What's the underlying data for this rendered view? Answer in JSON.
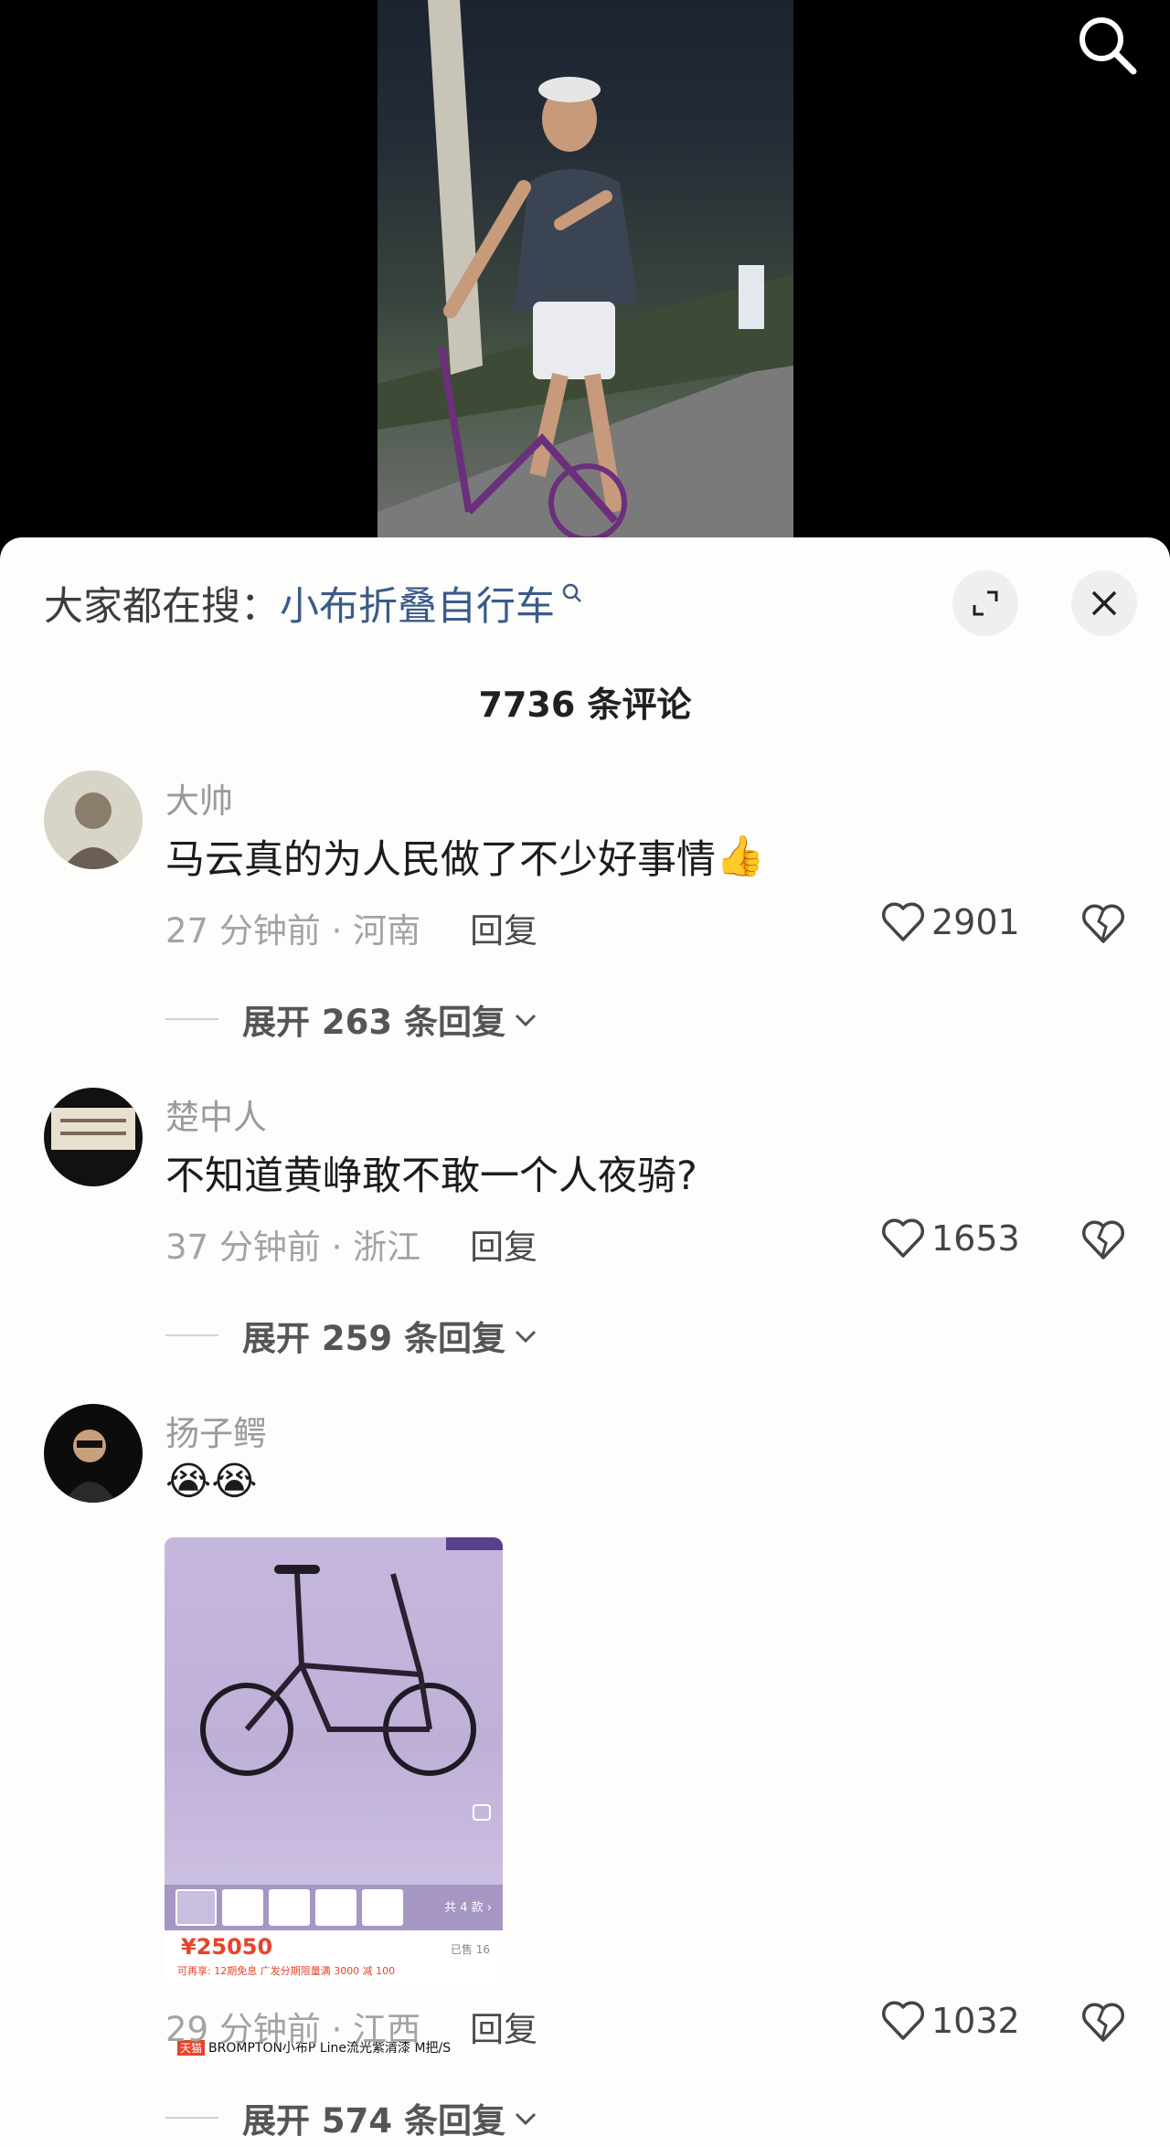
{
  "header": {
    "search_icon": "search-icon"
  },
  "sheet": {
    "suggest_prefix": "大家都在搜：",
    "suggest_term": "小布折叠自行车",
    "expand_icon": "expand-icon",
    "close_icon": "close-icon",
    "comment_count_title": "7736 条评论"
  },
  "comments": [
    {
      "user": "大帅",
      "text": "马云真的为人民做了不少好事情",
      "emoji": "👍",
      "time_location": "27 分钟前 · 河南",
      "reply_label": "回复",
      "likes": "2901",
      "expand_label": "展开 263 条回复"
    },
    {
      "user": "楚中人",
      "text": "不知道黄峥敢不敢一个人夜骑?",
      "time_location": "37 分钟前 · 浙江",
      "reply_label": "回复",
      "likes": "1653",
      "expand_label": "展开 259 条回复"
    },
    {
      "user": "扬子鳄",
      "text": "😭😭",
      "time_location": "29 分钟前 · 江西",
      "reply_label": "回复",
      "likes": "1032",
      "expand_label": "展开 574 条回复",
      "product": {
        "thumb_count": "共 4 款 ›",
        "price": "¥25050",
        "sold": "已售 16",
        "promo": "可再享: 12期免息  广发分期限量满 3000 减 100",
        "store_tag": "天猫",
        "title": "BROMPTON小布P Line流光紫清漆 M把/S"
      }
    }
  ],
  "colors": {
    "sheet_bg": "#fdfdfb",
    "link": "#3a5a89",
    "price": "#e8432a"
  }
}
